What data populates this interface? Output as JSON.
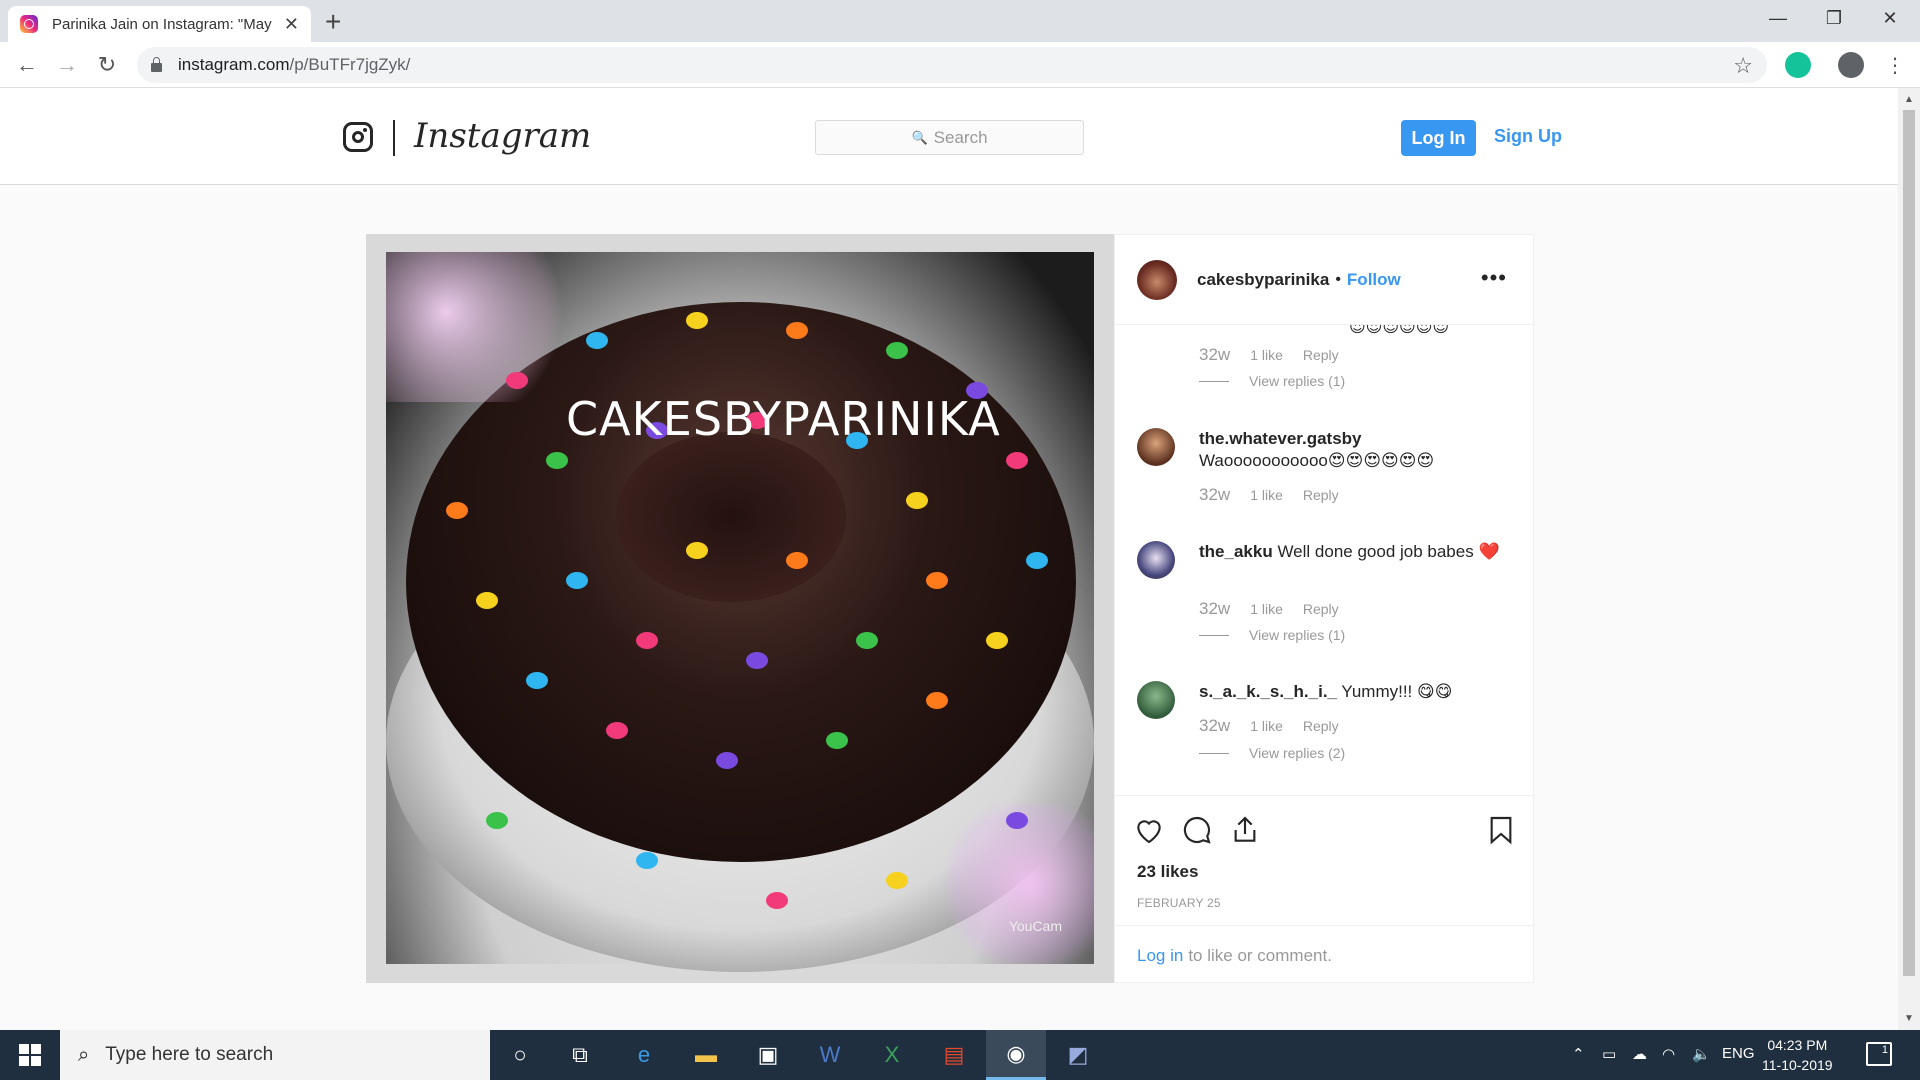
{
  "browser": {
    "tab_title": "Parinika Jain on Instagram: \"May",
    "url_host": "instagram.com",
    "url_path": "/p/BuTFr7jgZyk/"
  },
  "header": {
    "wordmark": "Instagram",
    "search_placeholder": "Search",
    "login_label": "Log In",
    "signup_label": "Sign Up"
  },
  "post": {
    "image_watermark": "CAKESBYPARINIKA",
    "image_corner_mark": "YouCam",
    "username": "cakesbyparinika",
    "dot": "•",
    "follow_label": "Follow",
    "more_icon": "•••",
    "comments": [
      {
        "user": "",
        "text": "",
        "age": "32w",
        "likes": "1 like",
        "reply_label": "Reply",
        "view_replies": "View replies (1)"
      },
      {
        "user": "the.whatever.gatsby",
        "text": "Waooooooooooo😍😍😍😍😍😍",
        "age": "32w",
        "likes": "1 like",
        "reply_label": "Reply",
        "view_replies": ""
      },
      {
        "user": "the_akku",
        "text": "Well done good job babes ❤️",
        "age": "32w",
        "likes": "1 like",
        "reply_label": "Reply",
        "view_replies": "View replies (1)"
      },
      {
        "user": "s._a._k._s._h._i._",
        "text": "Yummy!!! 😋😋",
        "age": "32w",
        "likes": "1 like",
        "reply_label": "Reply",
        "view_replies": "View replies (2)"
      }
    ],
    "top_emoji_row": "😍😍😍😍😍😍",
    "likes_count": "23 likes",
    "date": "FEBRUARY 25",
    "login_link": "Log in",
    "login_suffix": "to like or comment."
  },
  "taskbar": {
    "search_placeholder": "Type here to search",
    "lang": "ENG",
    "time": "04:23 PM",
    "date": "11-10-2019",
    "notif_count": "1"
  }
}
